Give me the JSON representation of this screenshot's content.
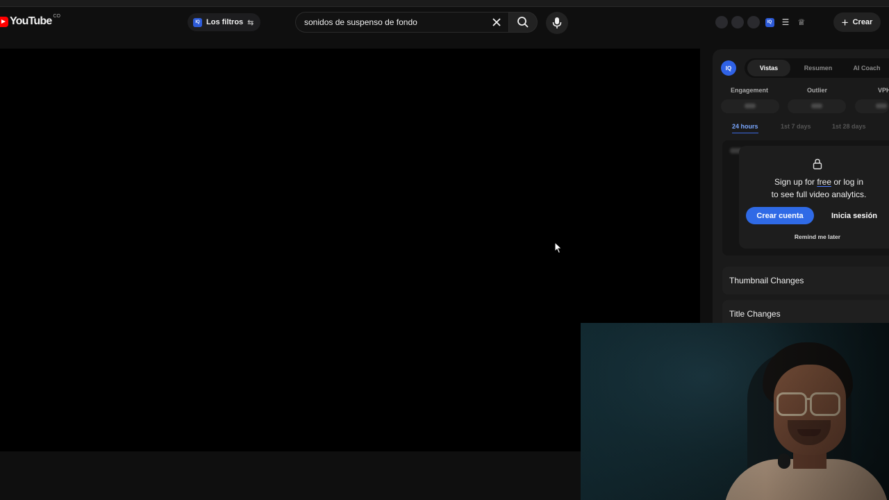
{
  "header": {
    "logo_text": "YouTube",
    "logo_country": "CO",
    "filters_badge": "IQ",
    "filters_label": "Los filtros",
    "search_value": "sonidos de suspenso de fondo",
    "create_label": "Crear",
    "right_badge": "IQ"
  },
  "panel": {
    "logo": "IQ",
    "tabs": [
      "Vistas",
      "Resumen",
      "AI Coach"
    ],
    "active_tab": "Vistas",
    "metrics": [
      "Engagement",
      "Outlier",
      "VPH"
    ],
    "ranges": [
      "24 hours",
      "1st 7 days",
      "1st 28 days"
    ],
    "active_range": "24 hours",
    "gate": {
      "line1_pre": "Sign up for ",
      "line1_free": "free",
      "line1_post": " or log in",
      "line2": "to see full video analytics.",
      "create_account": "Crear cuenta",
      "login": "Inicia sesión",
      "remind": "Remind me later"
    },
    "sections": [
      "Thumbnail Changes",
      "Title Changes"
    ]
  },
  "colors": {
    "accent": "#2f6ae6",
    "brand_red": "#ff0000",
    "background": "#0f0f0f"
  },
  "icons": [
    "youtube-logo-icon",
    "filter-sliders-icon",
    "close-icon",
    "search-icon",
    "mic-icon",
    "list-icon",
    "trophy-icon",
    "plus-icon",
    "lock-icon",
    "mouse-cursor-icon"
  ]
}
